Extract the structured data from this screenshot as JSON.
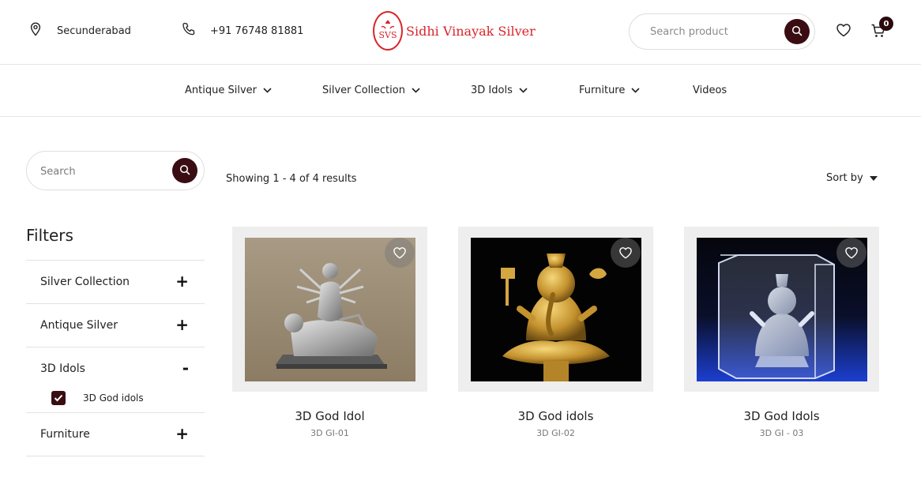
{
  "header": {
    "location": "Secunderabad",
    "phone": "+91 76748 81881",
    "brand": "Sidhi Vinayak Silver",
    "search_placeholder": "Search product",
    "cart_count": "0",
    "icons": [
      "location-pin-icon",
      "phone-icon",
      "search-icon",
      "heart-icon",
      "cart-icon"
    ]
  },
  "nav": {
    "items": [
      {
        "label": "Antique Silver"
      },
      {
        "label": "Silver Collection"
      },
      {
        "label": "3D Idols"
      },
      {
        "label": "Furniture"
      },
      {
        "label": "Videos"
      }
    ]
  },
  "sidebar": {
    "search_placeholder": "Search",
    "filters_title": "Filters",
    "groups": [
      {
        "label": "Silver Collection",
        "toggle": "+"
      },
      {
        "label": "Antique Silver",
        "toggle": "+"
      },
      {
        "label": "3D Idols",
        "toggle": "-"
      },
      {
        "label": "Furniture",
        "toggle": "+"
      }
    ],
    "checked_option": "3D God idols"
  },
  "toolbar": {
    "results_text": "Showing 1 - 4 of 4 results",
    "sort_label": "Sort by"
  },
  "products": [
    {
      "title": "3D God Idol",
      "sku": "3D GI-01"
    },
    {
      "title": "3D God idols",
      "sku": "3D GI-02"
    },
    {
      "title": "3D God Idols",
      "sku": "3D GI - 03"
    }
  ],
  "colors": {
    "accent": "#3a0d12",
    "brand_red": "#d9242a",
    "card_bg": "#eeeeee"
  }
}
